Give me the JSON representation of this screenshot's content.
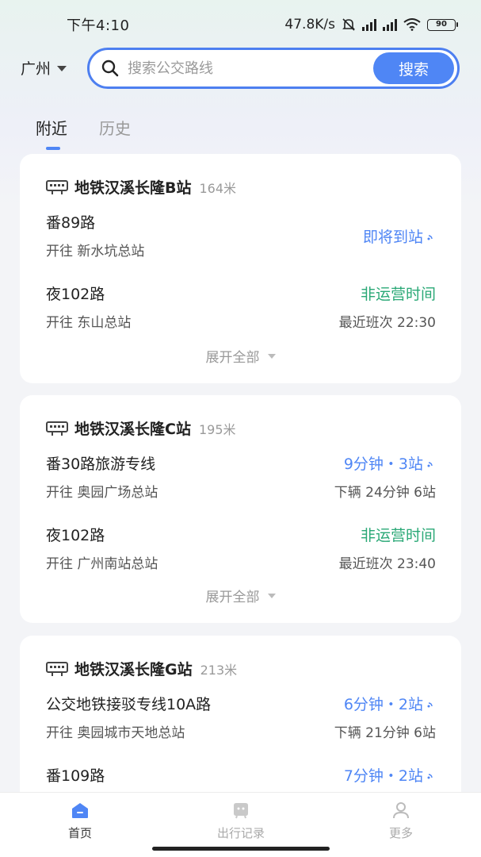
{
  "status_bar": {
    "time": "下午4:10",
    "net_speed": "47.8K/s",
    "battery": "90"
  },
  "header": {
    "city": "广州",
    "search_placeholder": "搜索公交路线",
    "search_button": "搜索"
  },
  "tabs": [
    {
      "label": "附近",
      "active": true
    },
    {
      "label": "历史",
      "active": false
    }
  ],
  "stations": [
    {
      "name": "地铁汉溪长隆B站",
      "distance": "164米",
      "routes": [
        {
          "name": "番89路",
          "direction": "开往 新水坑总站",
          "status": "即将到站",
          "status_color": "blue",
          "sub": ""
        },
        {
          "name": "夜102路",
          "direction": "开往 东山总站",
          "status": "非运营时间",
          "status_color": "green",
          "sub": "最近班次 22:30"
        }
      ],
      "expand_label": "展开全部"
    },
    {
      "name": "地铁汉溪长隆C站",
      "distance": "195米",
      "routes": [
        {
          "name": "番30路旅游专线",
          "direction": "开往 奥园广场总站",
          "status": "9分钟・3站",
          "status_color": "blue",
          "sub": "下辆 24分钟 6站"
        },
        {
          "name": "夜102路",
          "direction": "开往 广州南站总站",
          "status": "非运营时间",
          "status_color": "green",
          "sub": "最近班次 23:40"
        }
      ],
      "expand_label": "展开全部"
    },
    {
      "name": "地铁汉溪长隆G站",
      "distance": "213米",
      "routes": [
        {
          "name": "公交地铁接驳专线10A路",
          "direction": "开往 奥园城市天地总站",
          "status": "6分钟・2站",
          "status_color": "blue",
          "sub": "下辆 21分钟 6站"
        },
        {
          "name": "番109路",
          "direction": "",
          "status": "7分钟・2站",
          "status_color": "blue",
          "sub": ""
        }
      ]
    }
  ],
  "bottom_nav": [
    {
      "label": "首页",
      "icon": "home-icon",
      "active": true
    },
    {
      "label": "出行记录",
      "icon": "trip-record-icon",
      "active": false
    },
    {
      "label": "更多",
      "icon": "profile-icon",
      "active": false
    }
  ],
  "colors": {
    "accent": "#4f86f5",
    "green": "#2aa876"
  }
}
